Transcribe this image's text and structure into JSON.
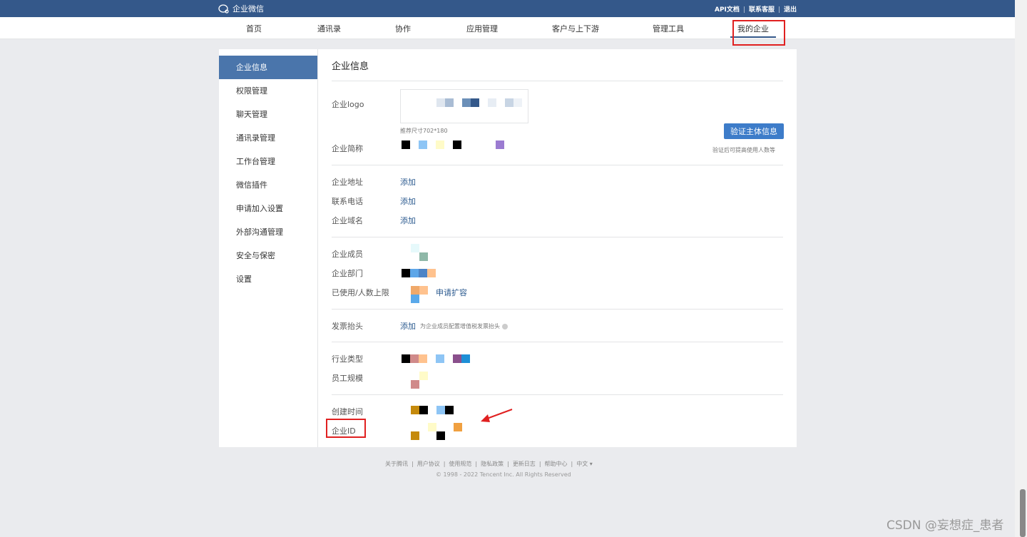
{
  "header": {
    "brand": "企业微信",
    "links": [
      "API文档",
      "联系客服",
      "退出"
    ]
  },
  "nav": {
    "items": [
      "首页",
      "通讯录",
      "协作",
      "应用管理",
      "客户与上下游",
      "管理工具",
      "我的企业"
    ],
    "active": "我的企业"
  },
  "sidebar": {
    "items": [
      "企业信息",
      "权限管理",
      "聊天管理",
      "通讯录管理",
      "工作台管理",
      "微信插件",
      "申请加入设置",
      "外部沟通管理",
      "安全与保密",
      "设置"
    ],
    "active": "企业信息"
  },
  "main": {
    "title": "企业信息",
    "logo_label": "企业logo",
    "logo_hint": "推荐尺寸702*180",
    "short_name_label": "企业简称",
    "verify_button": "验证主体信息",
    "verify_note": "验证后可提高使用人数等",
    "address_label": "企业地址",
    "phone_label": "联系电话",
    "domain_label": "企业域名",
    "add_text": "添加",
    "members_label": "企业成员",
    "departments_label": "企业部门",
    "quota_label": "已使用/人数上限",
    "expand_link": "申请扩容",
    "invoice_label": "发票抬头",
    "invoice_note": "为企业成员配置增值税发票抬头",
    "industry_label": "行业类型",
    "scale_label": "员工规模",
    "created_label": "创建时间",
    "corp_id_label": "企业ID"
  },
  "footer": {
    "links": [
      "关于腾讯",
      "用户协议",
      "使用规范",
      "隐私政策",
      "更新日志",
      "帮助中心",
      "中文 ▾"
    ],
    "copyright": "© 1998 - 2022 Tencent Inc. All Rights Reserved"
  },
  "watermark": "CSDN @妄想症_患者",
  "colors": {
    "topbar": "#34588a",
    "sidebar_active": "#4a75ab",
    "button": "#3d7cc9",
    "link": "#2b5a8f",
    "highlight": "#e02020"
  },
  "icons": [
    "wecom-logo-icon",
    "info-icon",
    "red-arrow-icon"
  ]
}
